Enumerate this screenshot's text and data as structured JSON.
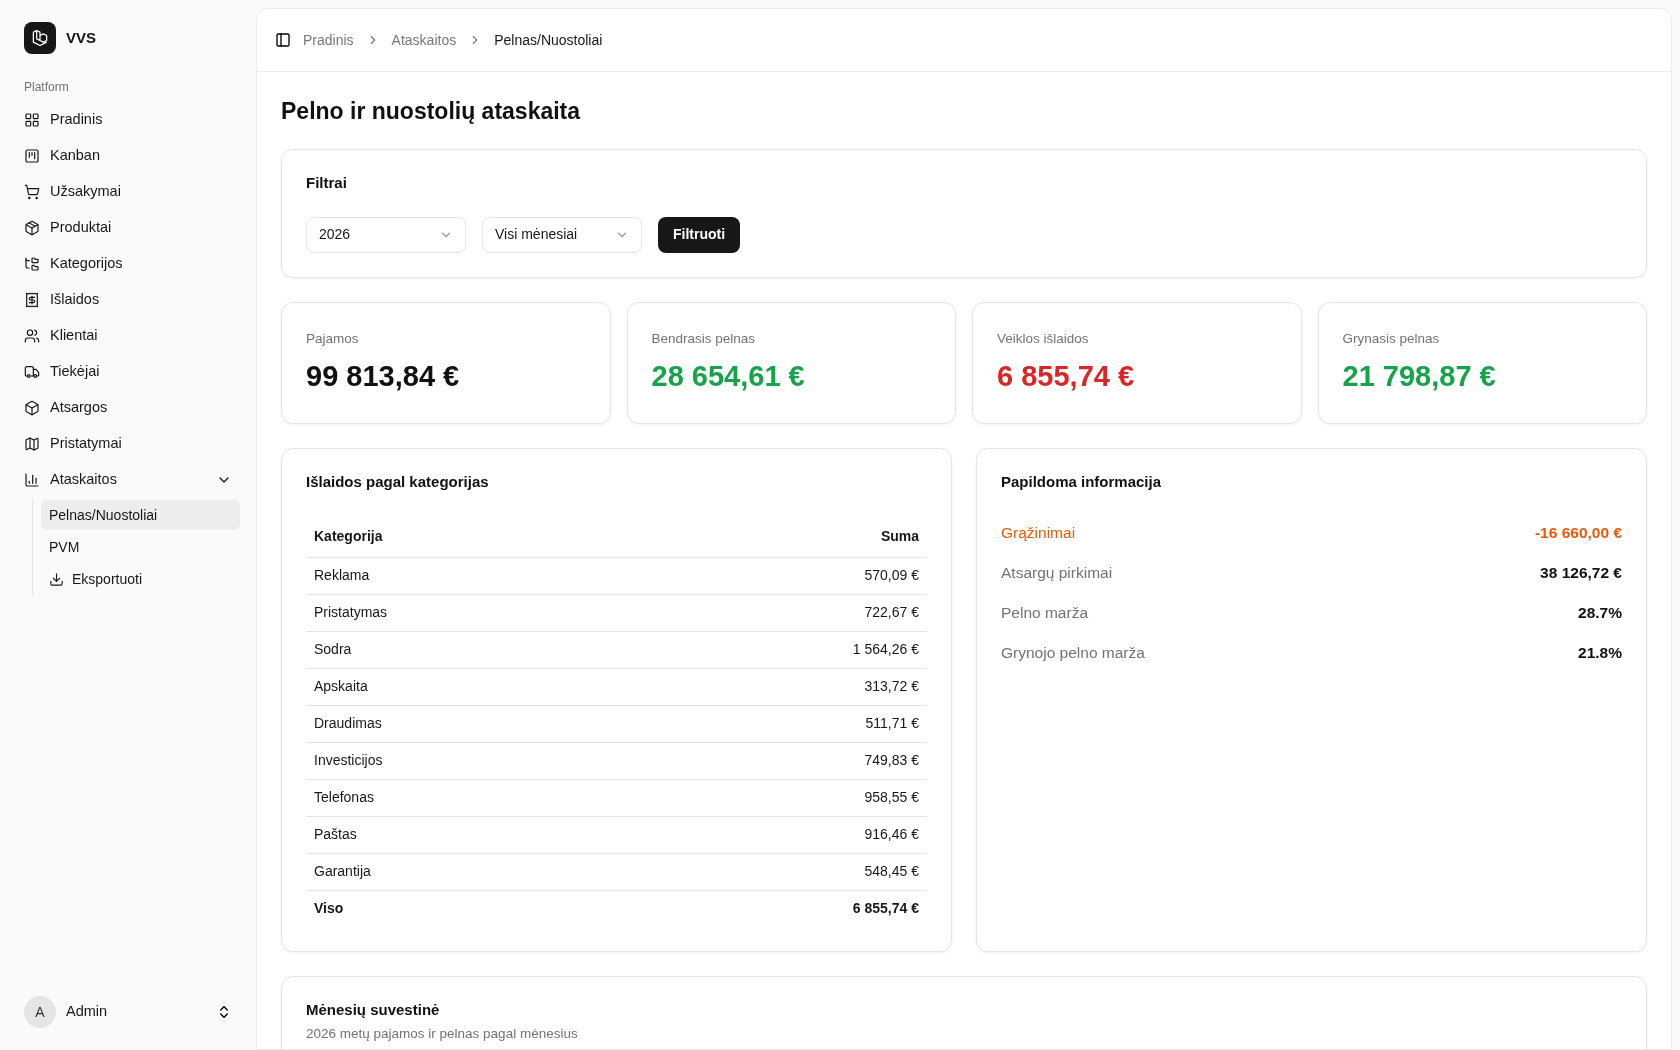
{
  "app": {
    "name": "VVS"
  },
  "sidebar": {
    "section": "Platform",
    "items": [
      {
        "label": "Pradinis",
        "selected": false
      },
      {
        "label": "Kanban",
        "selected": false
      },
      {
        "label": "Užsakymai",
        "selected": false
      },
      {
        "label": "Produktai",
        "selected": false
      },
      {
        "label": "Kategorijos",
        "selected": false
      },
      {
        "label": "Išlaidos",
        "selected": false
      },
      {
        "label": "Klientai",
        "selected": false
      },
      {
        "label": "Tiekėjai",
        "selected": false
      },
      {
        "label": "Atsargos",
        "selected": false
      },
      {
        "label": "Pristatymai",
        "selected": false
      },
      {
        "label": "Ataskaitos",
        "selected": false,
        "expanded": true,
        "children": [
          {
            "label": "Pelnas/Nuostoliai",
            "selected": true,
            "kind": "text"
          },
          {
            "label": "PVM",
            "selected": false,
            "kind": "text"
          },
          {
            "label": "Eksportuoti",
            "selected": false,
            "kind": "download"
          }
        ]
      }
    ],
    "user": {
      "initial": "A",
      "name": "Admin"
    }
  },
  "breadcrumb": [
    "Pradinis",
    "Ataskaitos",
    "Pelnas/Nuostoliai"
  ],
  "title": "Pelno ir nuostolių ataskaita",
  "filters": {
    "title": "Filtrai",
    "selects": [
      "2026",
      "Visi mėnesiai"
    ],
    "button": "Filtruoti"
  },
  "stats": [
    {
      "label": "Pajamos",
      "value": "99 813,84 €",
      "kind": "neutral"
    },
    {
      "label": "Bendrasis pelnas",
      "value": "28 654,61 €",
      "kind": "positive"
    },
    {
      "label": "Veiklos išlaidos",
      "value": "6 855,74 €",
      "kind": "negative"
    },
    {
      "label": "Grynasis pelnas",
      "value": "21 798,87 €",
      "kind": "positive"
    }
  ],
  "expenses": {
    "title": "Išlaidos pagal kategorijas",
    "columns": [
      "Kategorija",
      "Suma"
    ],
    "rows": [
      [
        "Reklama",
        "570,09 €"
      ],
      [
        "Pristatymas",
        "722,67 €"
      ],
      [
        "Sodra",
        "1 564,26 €"
      ],
      [
        "Apskaita",
        "313,72 €"
      ],
      [
        "Draudimas",
        "511,71 €"
      ],
      [
        "Investicijos",
        "749,83 €"
      ],
      [
        "Telefonas",
        "958,55 €"
      ],
      [
        "Paštas",
        "916,46 €"
      ],
      [
        "Garantija",
        "548,45 €"
      ]
    ],
    "total": [
      "Viso",
      "6 855,74 €"
    ]
  },
  "info": {
    "title": "Papildoma informacija",
    "rows": [
      {
        "label": "Grąžinimai",
        "value": "-16 660,00 €",
        "kind": "warning"
      },
      {
        "label": "Atsargų pirkimai",
        "value": "38 126,72 €",
        "kind": "neutral"
      },
      {
        "label": "Pelno marža",
        "value": "28.7%",
        "kind": "neutral"
      },
      {
        "label": "Grynojo pelno marža",
        "value": "21.8%",
        "kind": "neutral"
      }
    ]
  },
  "monthly": {
    "title": "Mėnesių suvestinė",
    "subtitle": "2026 metų pajamos ir pelnas pagal mėnesius"
  }
}
